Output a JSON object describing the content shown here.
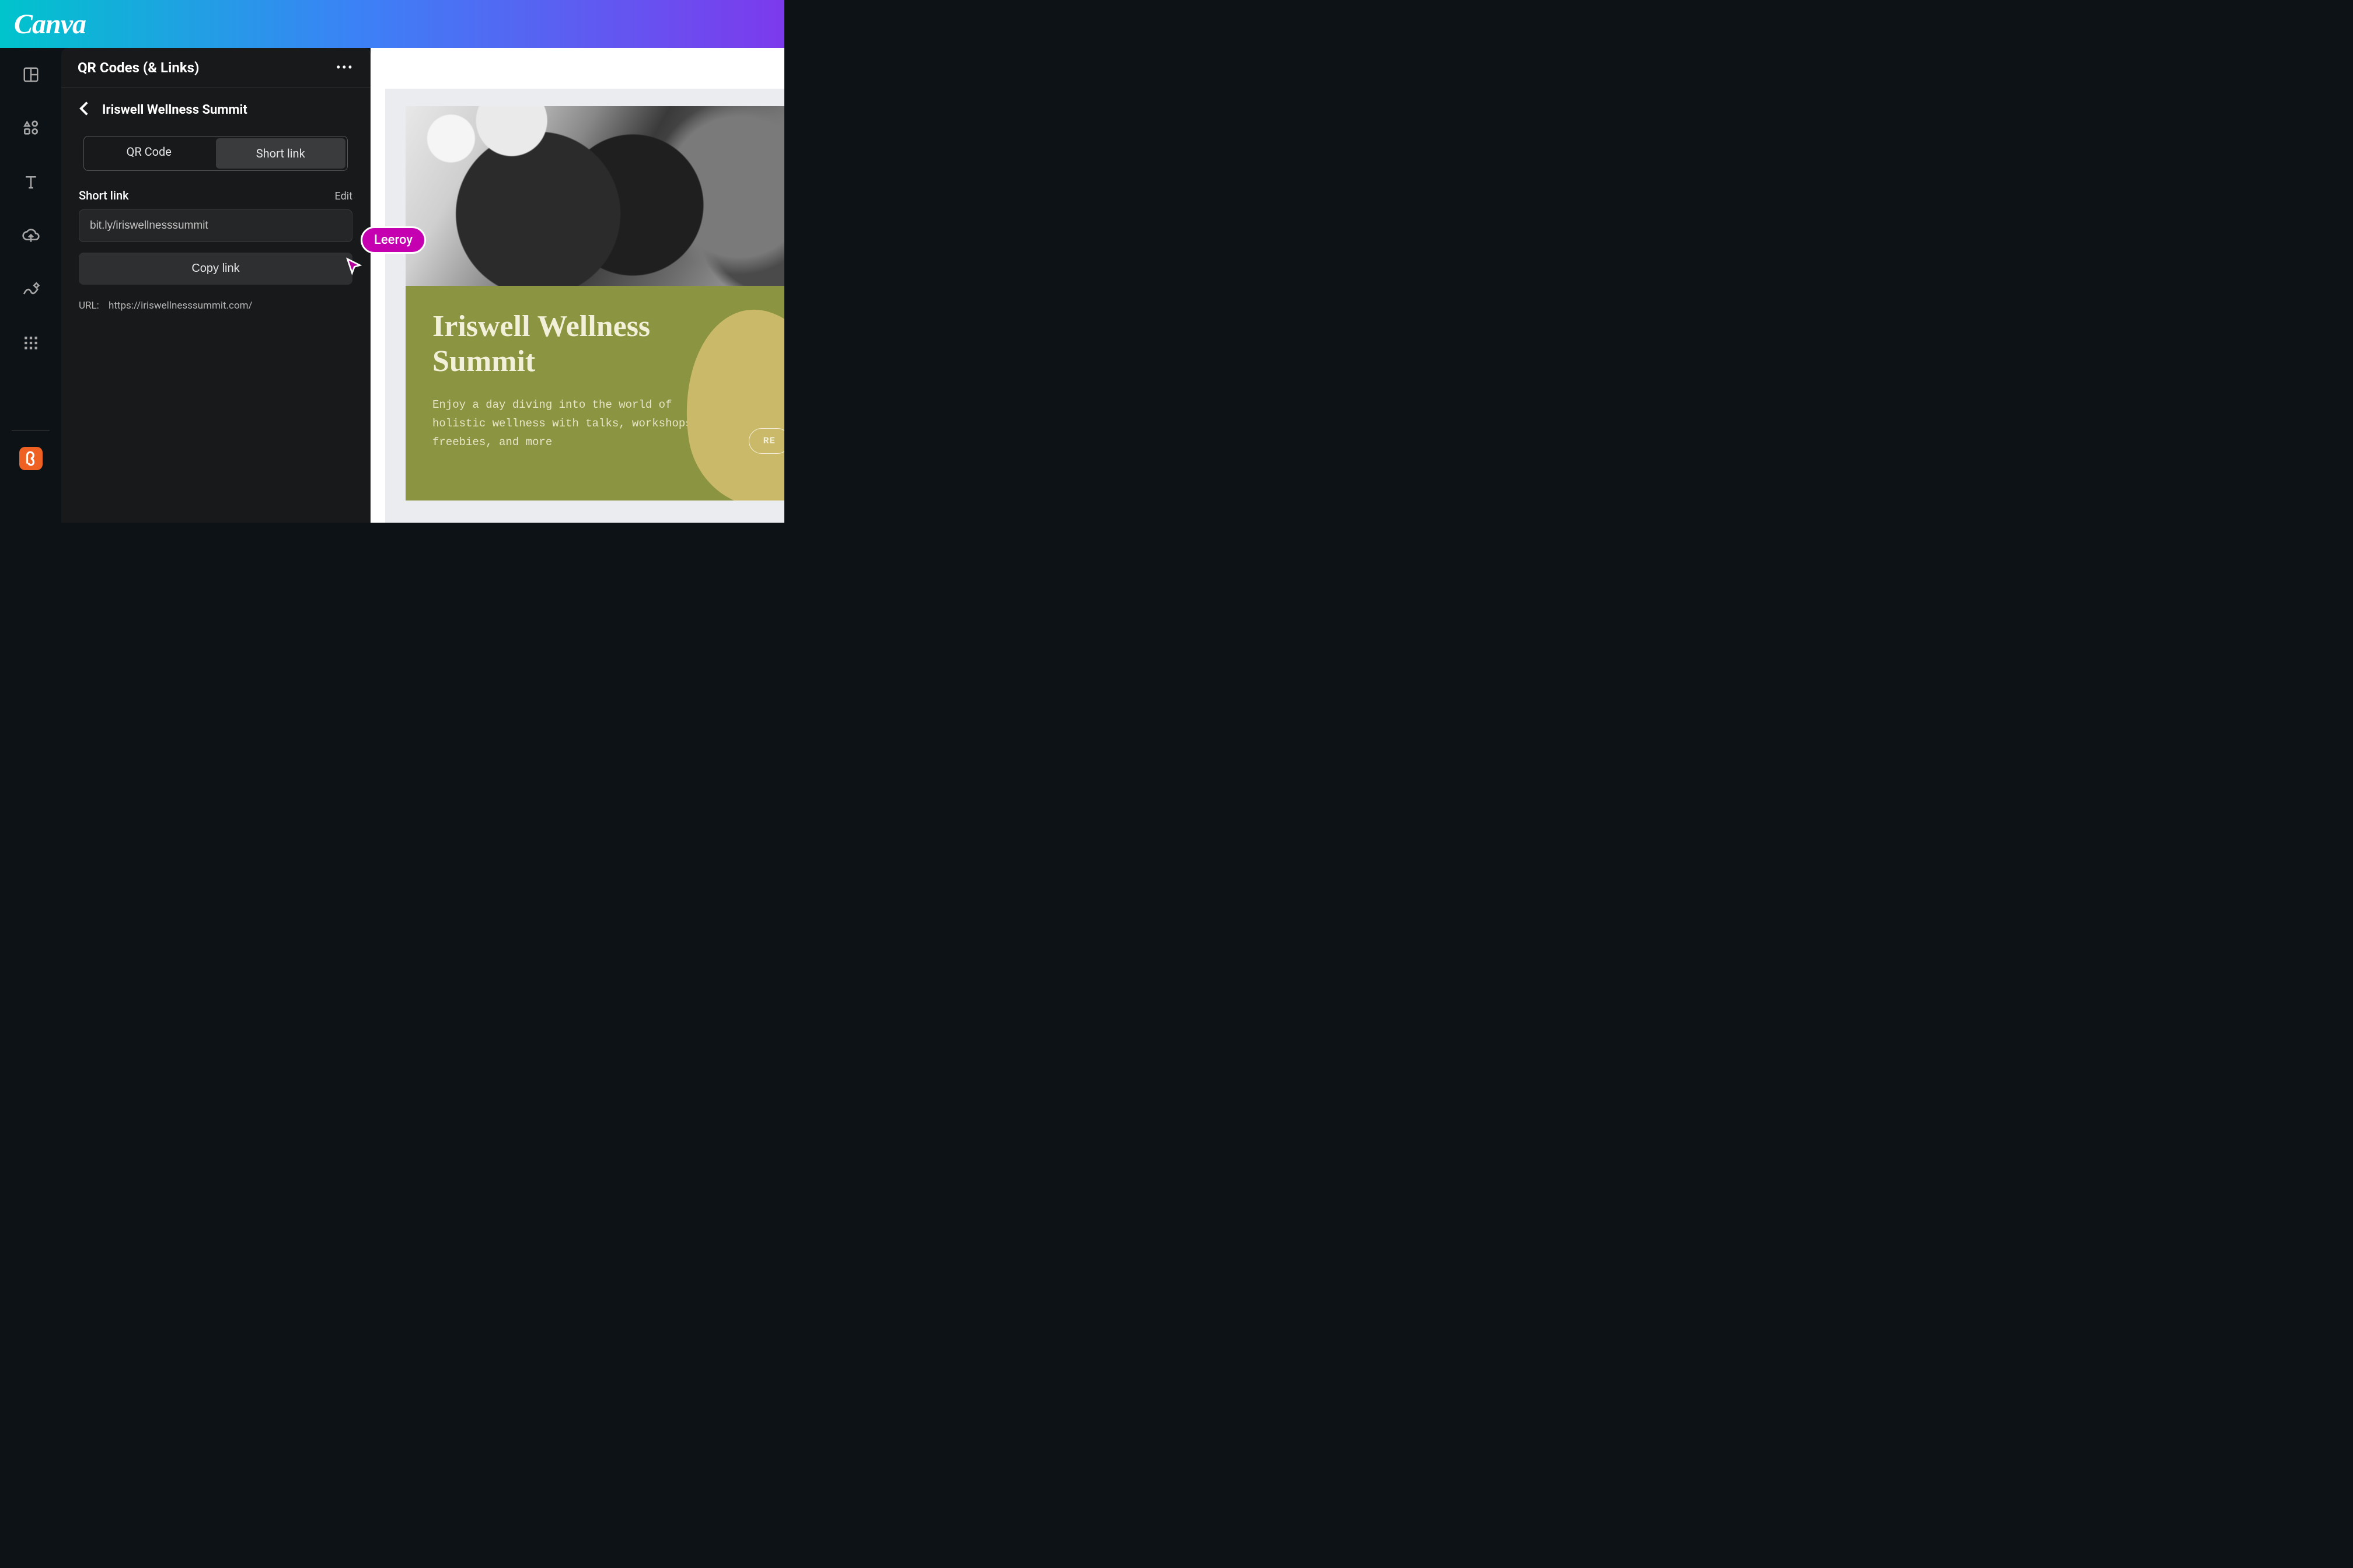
{
  "brand": {
    "logo_text": "Canva"
  },
  "panel": {
    "title": "QR Codes (& Links)",
    "crumb_title": "Iriswell Wellness Summit",
    "tabs": {
      "qr": "QR Code",
      "short": "Short link"
    },
    "field_label": "Short link",
    "edit_label": "Edit",
    "short_link_value": "bit.ly/iriswellnesssummit",
    "copy_label": "Copy link",
    "url_label": "URL:",
    "url_value": "https://iriswellnesssummit.com/"
  },
  "cursor": {
    "name": "Leeroy"
  },
  "design": {
    "title": "Iriswell Wellness Summit",
    "description": "Enjoy a day diving into the world of holistic wellness with talks, workshops, freebies, and more",
    "button_label": "RE"
  },
  "colors": {
    "accent_olive": "#8b9440",
    "cursor_magenta": "#c500b0",
    "bitly_orange": "#ee6123"
  }
}
